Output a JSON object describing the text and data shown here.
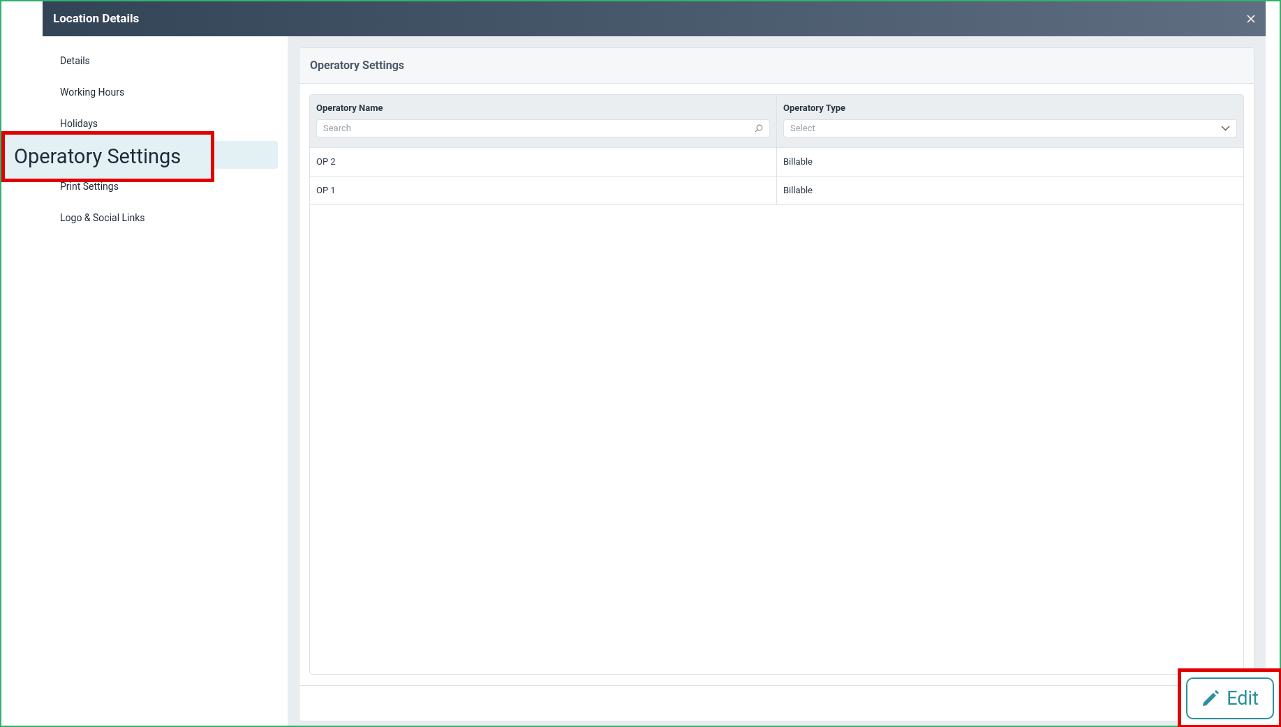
{
  "window": {
    "title": "Location Details"
  },
  "sidebar": {
    "items": [
      {
        "label": "Details",
        "selected": false
      },
      {
        "label": "Working Hours",
        "selected": false
      },
      {
        "label": "Holidays",
        "selected": false
      },
      {
        "selected": true
      },
      {
        "label": "Print Settings",
        "selected": false
      },
      {
        "label": "Logo & Social Links",
        "selected": false
      }
    ]
  },
  "panel": {
    "title": "Operatory Settings",
    "table": {
      "columns": [
        {
          "label": "Operatory Name",
          "filter": {
            "kind": "search",
            "placeholder": "Search"
          }
        },
        {
          "label": "Operatory Type",
          "filter": {
            "kind": "select",
            "placeholder": "Select"
          }
        }
      ],
      "rows": [
        [
          "OP 2",
          "Billable"
        ],
        [
          "OP 1",
          "Billable"
        ]
      ]
    }
  },
  "callouts": [
    {
      "kind": "label",
      "text": "Operatory Settings"
    },
    {
      "kind": "button",
      "text": "Edit"
    }
  ]
}
